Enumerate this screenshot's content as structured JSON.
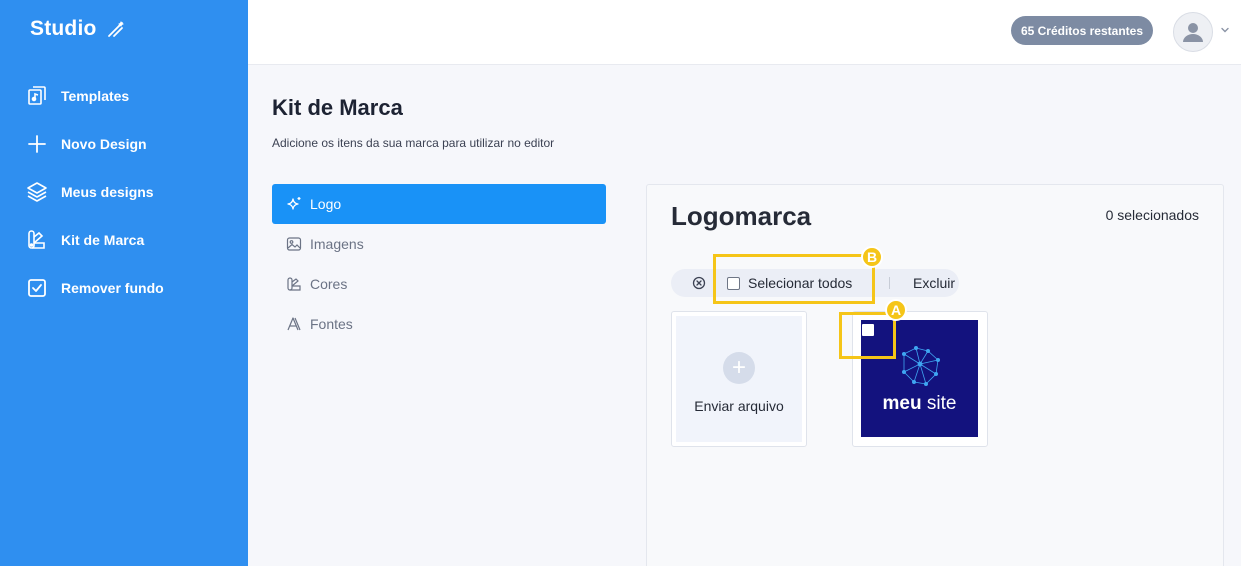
{
  "sidebar": {
    "brand": "Studio",
    "items": [
      {
        "label": "Templates",
        "icon": "templates-icon"
      },
      {
        "label": "Novo Design",
        "icon": "plus-icon"
      },
      {
        "label": "Meus designs",
        "icon": "layers-icon"
      },
      {
        "label": "Kit de Marca",
        "icon": "brand-kit-icon"
      },
      {
        "label": "Remover fundo",
        "icon": "check-square-icon"
      }
    ]
  },
  "topbar": {
    "credits": "65 Créditos restantes"
  },
  "page": {
    "title": "Kit de Marca",
    "subtitle": "Adicione os itens da sua marca para utilizar no editor"
  },
  "tabs": [
    {
      "label": "Logo",
      "icon": "sparkle-icon",
      "active": true
    },
    {
      "label": "Imagens",
      "icon": "image-icon"
    },
    {
      "label": "Cores",
      "icon": "palette-icon"
    },
    {
      "label": "Fontes",
      "icon": "font-icon"
    }
  ],
  "panel": {
    "title": "Logomarca",
    "selected_count": "0 selecionados",
    "toolbar": {
      "select_all": "Selecionar todos",
      "delete": "Excluir"
    },
    "upload_label": "Enviar arquivo",
    "logo": {
      "text_bold": "meu",
      "text_regular": "site",
      "bg_color": "#13127e"
    }
  },
  "annotations": {
    "a": "A",
    "b": "B",
    "color": "#f5c518"
  },
  "colors": {
    "sidebar": "#2f8ff0",
    "active_tab": "#1992f7",
    "credits_badge": "#7d8ba3"
  }
}
